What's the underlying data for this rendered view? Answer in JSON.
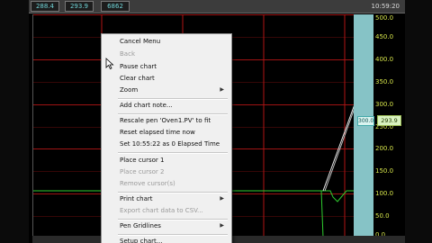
{
  "topbar": {
    "pv_values": [
      "288.4",
      "293.9",
      "6862"
    ],
    "time": "10:59:20"
  },
  "scale": {
    "labels": [
      "500.0",
      "450.0",
      "400.0",
      "350.0",
      "300.0",
      "250.0",
      "200.0",
      "150.0",
      "100.0",
      "50.0",
      "0.0"
    ],
    "pen_marker": "300.0",
    "pen_value": "293.9",
    "bar_color": "#86c3c6",
    "label_color": "#d7e64b"
  },
  "menu": {
    "items": [
      {
        "label": "Cancel Menu",
        "enabled": true,
        "submenu": false
      },
      {
        "label": "Back",
        "enabled": false,
        "submenu": false
      },
      {
        "label": "Pause chart",
        "enabled": true,
        "submenu": false
      },
      {
        "label": "Clear chart",
        "enabled": true,
        "submenu": false
      },
      {
        "label": "Zoom",
        "enabled": true,
        "submenu": true
      },
      {
        "label": "Add chart note...",
        "enabled": true,
        "submenu": false
      },
      {
        "label": "Rescale pen 'Oven1.PV' to fit",
        "enabled": true,
        "submenu": false
      },
      {
        "label": "Reset elapsed time now",
        "enabled": true,
        "submenu": false
      },
      {
        "label": "Set 10:55:22 as 0 Elapsed Time",
        "enabled": true,
        "submenu": false
      },
      {
        "label": "Place cursor 1",
        "enabled": true,
        "submenu": false
      },
      {
        "label": "Place cursor 2",
        "enabled": false,
        "submenu": false
      },
      {
        "label": "Remove cursor(s)",
        "enabled": false,
        "submenu": false
      },
      {
        "label": "Print chart",
        "enabled": true,
        "submenu": true
      },
      {
        "label": "Export chart data to CSV...",
        "enabled": false,
        "submenu": false
      },
      {
        "label": "Pen Gridlines",
        "enabled": true,
        "submenu": true
      },
      {
        "label": "Setup chart...",
        "enabled": true,
        "submenu": false
      }
    ]
  },
  "colors": {
    "grid_red": "#b01515",
    "trend_green": "#2fcc2f",
    "trend_white": "#e8e8e8",
    "menu_bg": "#f0f0f0"
  }
}
